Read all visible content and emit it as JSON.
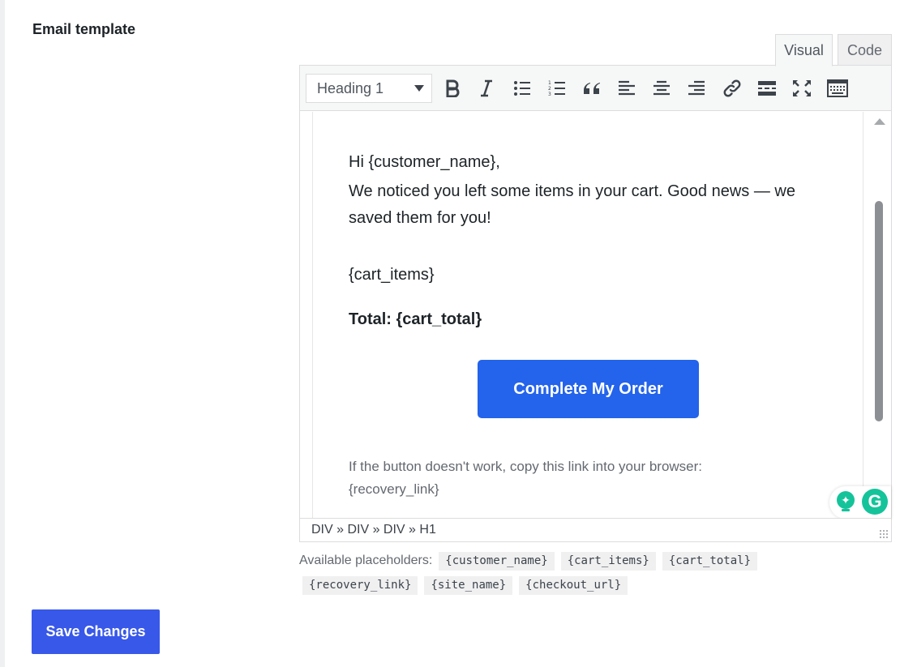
{
  "field": {
    "label": "Email template"
  },
  "tabs": [
    {
      "label": "Visual",
      "active": true
    },
    {
      "label": "Code",
      "active": false
    }
  ],
  "toolbar": {
    "format_value": "Heading 1",
    "buttons": [
      "bold-icon",
      "italic-icon",
      "bullet-list-icon",
      "numbered-list-icon",
      "blockquote-icon",
      "align-left-icon",
      "align-center-icon",
      "align-right-icon",
      "link-icon",
      "read-more-icon",
      "fullscreen-icon",
      "toolbar-toggle-icon"
    ]
  },
  "content": {
    "greeting": "Hi {customer_name},",
    "body": "We noticed you left some items in your cart. Good news — we saved them for you!",
    "items": "{cart_items}",
    "total": "Total: {cart_total}",
    "cta_label": "Complete My Order",
    "footnote_line1": "If the button doesn't work, copy this link into your browser:",
    "footnote_line2": "{recovery_link}"
  },
  "statusbar": {
    "path": "DIV » DIV » DIV » H1"
  },
  "placeholders": {
    "label": "Available placeholders:",
    "items": [
      "{customer_name}",
      "{cart_items}",
      "{cart_total}",
      "{recovery_link}",
      "{site_name}",
      "{checkout_url}"
    ]
  },
  "save_button": {
    "label": "Save Changes"
  },
  "colors": {
    "cta": "#2463eb",
    "save": "#3858e9",
    "grammarly": "#15c39a"
  }
}
